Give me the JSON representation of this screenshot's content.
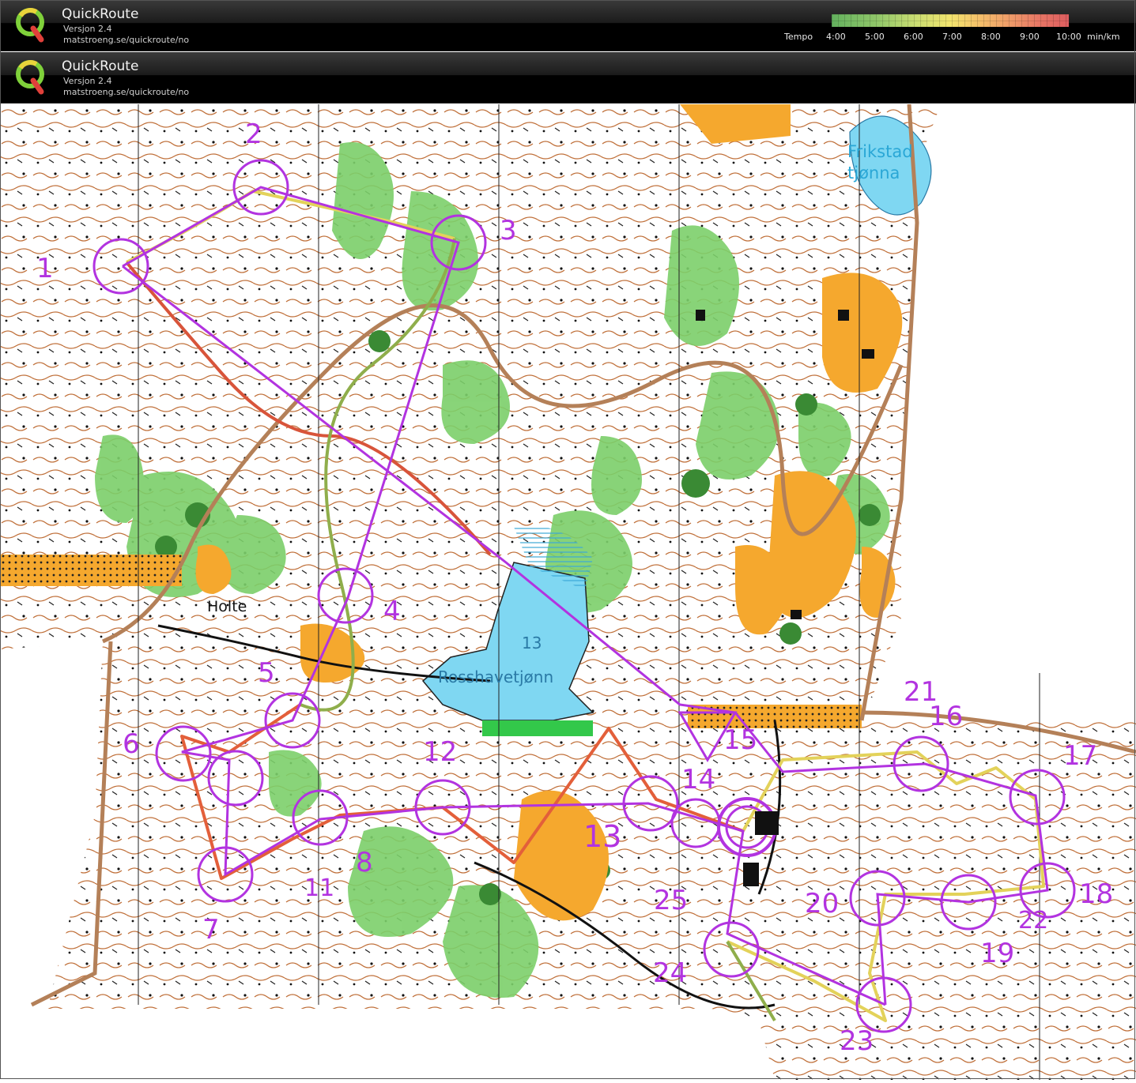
{
  "header": {
    "app_title": "QuickRoute",
    "version": "Versjon 2.4",
    "url": "matstroeng.se/quickroute/no"
  },
  "header_second": {
    "app_title": "QuickRoute",
    "version": "Versjon 2.4",
    "url": "matstroeng.se/quickroute/no"
  },
  "legend": {
    "label": "Tempo",
    "ticks": [
      "4:00",
      "5:00",
      "6:00",
      "7:00",
      "8:00",
      "9:00",
      "10:00"
    ],
    "unit": "min/km"
  },
  "map": {
    "place_labels": [
      "Frikstad",
      "tjønna",
      "Holte",
      "13",
      "Rosshavetjønn"
    ],
    "control_numbers": [
      "1",
      "2",
      "3",
      "4",
      "5",
      "6",
      "7",
      "8",
      "11",
      "12",
      "13",
      "14",
      "15",
      "16",
      "17",
      "18",
      "19",
      "20",
      "21",
      "22",
      "23",
      "24",
      "25"
    ],
    "colors": {
      "course": "#b233e0",
      "water": "#7fd7f2",
      "green": "#7ccf6a",
      "open": "#f5a82e",
      "brown": "#b05a2a"
    }
  }
}
